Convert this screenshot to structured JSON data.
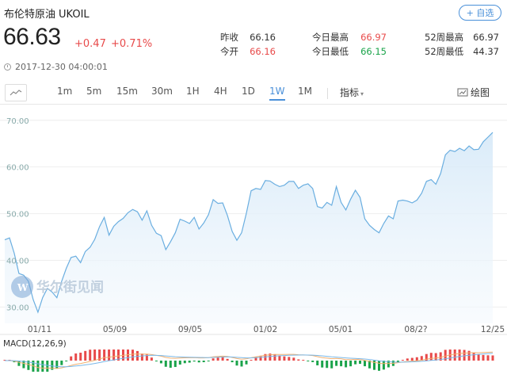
{
  "header": {
    "name": "布伦特原油",
    "code": "UKOIL",
    "watch_label": "+ 自选",
    "price": "66.63",
    "change": "+0.47",
    "change_pct": "+0.71%",
    "timestamp": "2017-12-30 04:00:01"
  },
  "stats": {
    "prev_close_label": "昨收",
    "prev_close": "66.16",
    "open_label": "今开",
    "open": "66.16",
    "day_high_label": "今日最高",
    "day_high": "66.97",
    "day_low_label": "今日最低",
    "day_low": "66.15",
    "wk52_high_label": "52周最高",
    "wk52_high": "66.97",
    "wk52_low_label": "52周最低",
    "wk52_low": "44.37"
  },
  "toolbar": {
    "periods": [
      "1m",
      "5m",
      "15m",
      "30m",
      "1H",
      "4H",
      "1D",
      "1W",
      "1M"
    ],
    "active_period": "1W",
    "indicator_label": "指标",
    "draw_label": "绘图"
  },
  "watermark": "华尔街见闻",
  "macd_label": "MACD(12,26,9)",
  "colors": {
    "up": "#e84a4a",
    "down": "#1aa34a",
    "accent": "#4a90d9",
    "line": "#6aaee0"
  },
  "chart_data": {
    "type": "area",
    "y_ticks": [
      "70.00",
      "60.00",
      "50.00",
      "40.00",
      "30.00"
    ],
    "ylim": [
      26.5,
      72
    ],
    "x_ticks": [
      "01/11",
      "05/09",
      "09/05",
      "01/02",
      "05/01",
      "08/2?",
      "12/25"
    ],
    "values": [
      44.4,
      44.8,
      41.5,
      37.2,
      36.8,
      35.5,
      31.6,
      28.9,
      32.0,
      34.0,
      33.2,
      32.0,
      35.5,
      38.3,
      40.6,
      40.9,
      39.5,
      41.9,
      42.8,
      44.5,
      47.2,
      49.2,
      45.4,
      47.3,
      48.3,
      49.0,
      50.2,
      50.9,
      50.4,
      48.6,
      50.6,
      47.5,
      45.8,
      45.3,
      42.3,
      44.0,
      45.9,
      48.8,
      48.4,
      47.9,
      49.2,
      46.7,
      48.0,
      49.8,
      53.0,
      52.2,
      52.3,
      49.6,
      46.2,
      44.3,
      45.9,
      50.1,
      54.9,
      55.4,
      55.2,
      57.1,
      57.0,
      56.3,
      55.8,
      56.1,
      56.9,
      56.9,
      55.4,
      56.1,
      56.4,
      55.4,
      51.5,
      51.2,
      52.4,
      51.8,
      55.8,
      52.4,
      50.8,
      53.1,
      55.0,
      53.5,
      48.9,
      47.5,
      46.6,
      45.9,
      47.9,
      49.5,
      48.9,
      52.7,
      52.9,
      52.7,
      52.3,
      52.9,
      54.4,
      56.9,
      57.3,
      56.3,
      58.6,
      62.6,
      63.6,
      63.3,
      64.0,
      63.5,
      64.5,
      63.7,
      63.8,
      65.4,
      66.4,
      67.4
    ]
  }
}
